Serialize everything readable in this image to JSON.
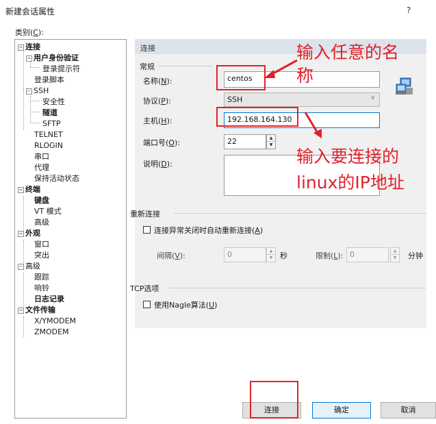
{
  "window": {
    "title": "新建会话属性",
    "help": "?"
  },
  "category": {
    "label_prefix": "类别(",
    "label_key": "C",
    "label_suffix": "):"
  },
  "tree": [
    {
      "label": "连接",
      "bold": true
    },
    {
      "label": "用户身份验证",
      "bold": true
    },
    {
      "label": "登录提示符",
      "bold": false
    },
    {
      "label": "登录脚本",
      "bold": false
    },
    {
      "label": "SSH",
      "bold": false
    },
    {
      "label": "安全性",
      "bold": false
    },
    {
      "label": "隧道",
      "bold": true
    },
    {
      "label": "SFTP",
      "bold": false
    },
    {
      "label": "TELNET",
      "bold": false
    },
    {
      "label": "RLOGIN",
      "bold": false
    },
    {
      "label": "串口",
      "bold": false
    },
    {
      "label": "代理",
      "bold": false
    },
    {
      "label": "保持活动状态",
      "bold": false
    },
    {
      "label": "终端",
      "bold": true
    },
    {
      "label": "键盘",
      "bold": true
    },
    {
      "label": "VT 模式",
      "bold": false
    },
    {
      "label": "高级",
      "bold": false
    },
    {
      "label": "外观",
      "bold": true
    },
    {
      "label": "窗口",
      "bold": false
    },
    {
      "label": "突出",
      "bold": false
    },
    {
      "label": "高级",
      "bold": false
    },
    {
      "label": "跟踪",
      "bold": false
    },
    {
      "label": "响铃",
      "bold": false
    },
    {
      "label": "日志记录",
      "bold": true
    },
    {
      "label": "文件传输",
      "bold": true
    },
    {
      "label": "X/YMODEM",
      "bold": false
    },
    {
      "label": "ZMODEM",
      "bold": false
    }
  ],
  "panel": {
    "header": "连接",
    "general": {
      "label": "常规",
      "name": {
        "label_prefix": "名称(",
        "label_key": "N",
        "label_suffix": "):",
        "value": "centos"
      },
      "protocol": {
        "label_prefix": "协议(",
        "label_key": "P",
        "label_suffix": "):",
        "value": "SSH"
      },
      "host": {
        "label_prefix": "主机(",
        "label_key": "H",
        "label_suffix": "):",
        "value": "192.168.164.130"
      },
      "port": {
        "label_prefix": "端口号(",
        "label_key": "O",
        "label_suffix": "):",
        "value": "22"
      },
      "description": {
        "label_prefix": "说明(",
        "label_key": "D",
        "label_suffix": "):",
        "value": ""
      }
    },
    "reconnect": {
      "label": "重新连接",
      "checkbox_prefix": "连接异常关闭时自动重新连接(",
      "checkbox_key": "A",
      "checkbox_suffix": ")",
      "interval": {
        "label_prefix": "间隔(",
        "label_key": "V",
        "label_suffix": "):",
        "value": "0",
        "unit": "秒"
      },
      "limit": {
        "label_prefix": "限制(",
        "label_key": "L",
        "label_suffix": "):",
        "value": "0",
        "unit": "分钟"
      }
    },
    "tcp": {
      "label": "TCP选项",
      "checkbox_prefix": "使用Nagle算法(",
      "checkbox_key": "U",
      "checkbox_suffix": ")"
    }
  },
  "buttons": {
    "connect": "连接",
    "ok": "确定",
    "cancel": "取消"
  },
  "annotations": {
    "name_hint": "输入任意的名称",
    "name_hint_line1": "输入任意的名",
    "name_hint_line2": "称",
    "ip_hint_line1": "输入要连接的",
    "ip_hint_line2": "linux的IP地址"
  },
  "colors": {
    "annotation_red": "#e0212b",
    "default_button_border": "#0078d7"
  }
}
